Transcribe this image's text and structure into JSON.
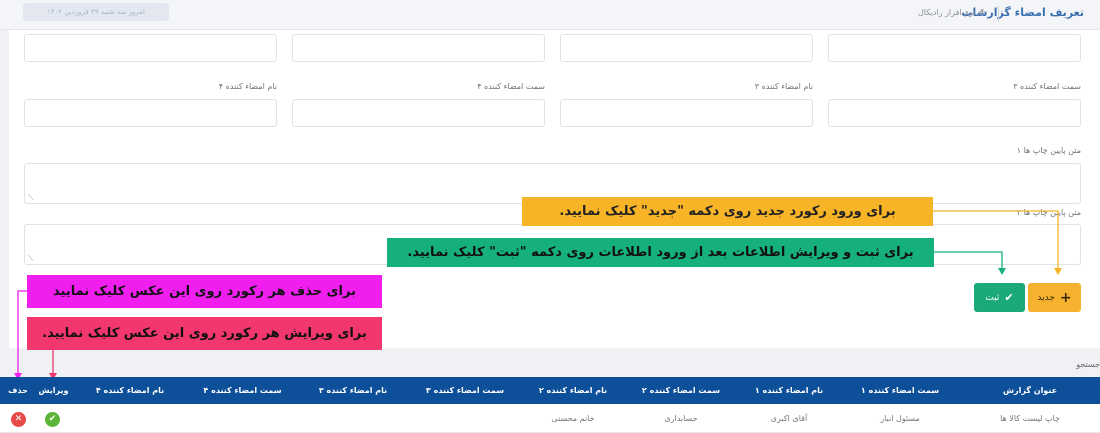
{
  "header": {
    "title": "تعریف امضاء گزارشات",
    "breadcrumb": "# نرم افزار رادیکال",
    "date_chip": "امروز سه شنبه ۲۹ فروردین ۱۴۰۲"
  },
  "form": {
    "labels": {
      "signer3_position": "سمت امضاء کننده ۳",
      "signer3_name": "نام امضاء کننده ۳",
      "signer4_position": "سمت امضاء کننده ۴",
      "signer4_name": "نام امضاء کننده ۴",
      "footer1": "متن پایین چاپ ها ۱",
      "footer2": "متن پایین چاپ ها ۲"
    },
    "buttons": {
      "new": "جدید",
      "save": "ثبت"
    }
  },
  "callouts": {
    "new": "برای ورود رکورد جدید روی دکمه \"جدید\" کلیک نمایید.",
    "save": "برای ثبت و ویرایش اطلاعات بعد از ورود اطلاعات روی دکمه \"ثبت\" کلیک نمایید.",
    "delete": "برای حذف هر رکورد روی این عکس کلیک نمایید",
    "edit": "برای ویرایش هر رکورد روی این عکس کلیک نمایید."
  },
  "colors": {
    "header_bg": "#0e4f99",
    "new_button": "#f6b22e",
    "save_button": "#1ba87a",
    "callout_new": "#f6b426",
    "callout_save": "#16b07c",
    "callout_delete": "#f01ff0",
    "callout_edit": "#f2366e"
  },
  "table": {
    "search_label": "جستجو",
    "columns": {
      "report_title": "عنوان گزارش",
      "signer1_position": "سمت امضاء کننده ۱",
      "signer1_name": "نام امضاء کننده ۱",
      "signer2_position": "سمت امضاء کننده ۲",
      "signer2_name": "نام امضاء کننده ۲",
      "signer3_position": "سمت امضاء کننده ۳",
      "signer3_name": "نام امضاء کننده ۳",
      "signer4_position": "سمت امضاء کننده ۴",
      "signer4_name": "نام امضاء کننده ۴",
      "edit": "ویرایش",
      "delete": "حذف"
    },
    "rows": [
      {
        "report_title": "چاپ لیست کالا ها",
        "signer1_position": "مسئول انبار",
        "signer1_name": "آقای اکبری",
        "signer2_position": "حسابداری",
        "signer2_name": "خانم محسنی"
      }
    ],
    "icons": {
      "delete": "close-icon",
      "edit": "check-icon"
    }
  }
}
